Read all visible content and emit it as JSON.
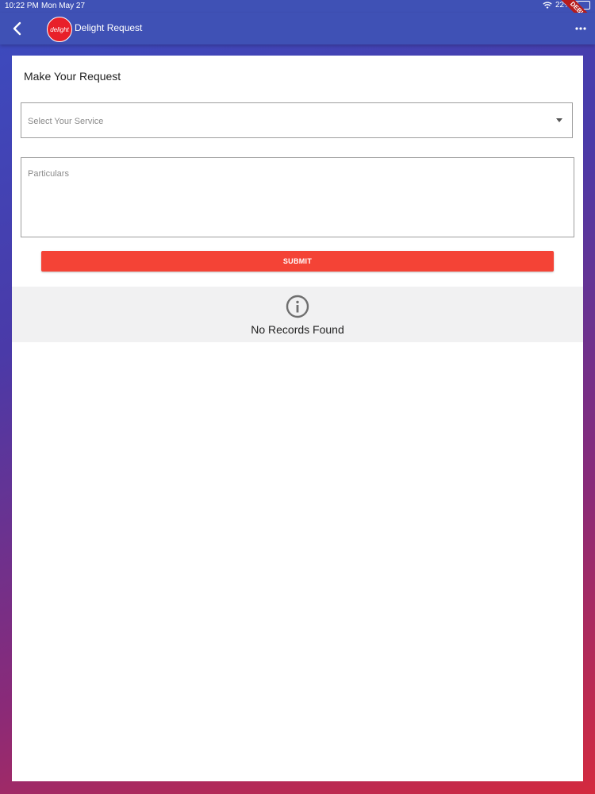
{
  "status_bar": {
    "time": "10:22 PM",
    "date": "Mon May 27",
    "battery": "22%",
    "debug_label": "DEBUG"
  },
  "app_bar": {
    "back_icon": "chevron-left-icon",
    "logo_text": "delight",
    "title": "Delight Request",
    "more_icon": "more-horizontal-icon",
    "color": "#3f51b5"
  },
  "form": {
    "section_title": "Make Your Request",
    "service_select": {
      "placeholder": "Select Your Service"
    },
    "particulars": {
      "placeholder": "Particulars",
      "value": ""
    },
    "submit_label": "SUBMIT",
    "submit_color": "#f44336"
  },
  "records": {
    "icon": "info-icon",
    "empty_message": "No Records Found"
  }
}
